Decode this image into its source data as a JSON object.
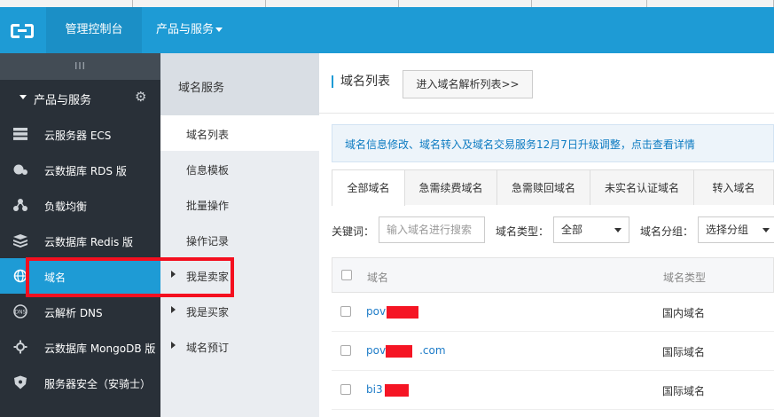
{
  "header": {
    "console_label": "管理控制台",
    "products_label": "产品与服务"
  },
  "sidebar": {
    "toggle_label": "III",
    "section_label": "产品与服务",
    "items": [
      {
        "label": "云服务器 ECS",
        "icon": "server-icon"
      },
      {
        "label": "云数据库 RDS 版",
        "icon": "database-icon"
      },
      {
        "label": "负载均衡",
        "icon": "load-balancer-icon"
      },
      {
        "label": "云数据库 Redis 版",
        "icon": "redis-icon"
      },
      {
        "label": "域名",
        "icon": "globe-icon",
        "active": true
      },
      {
        "label": "云解析 DNS",
        "icon": "dns-icon"
      },
      {
        "label": "云数据库 MongoDB 版",
        "icon": "mongodb-icon"
      },
      {
        "label": "服务器安全（安骑士）",
        "icon": "shield-icon"
      }
    ]
  },
  "subnav": {
    "title": "域名服务",
    "items": [
      {
        "label": "域名列表",
        "expandable": false,
        "active": true
      },
      {
        "label": "信息模板",
        "expandable": false
      },
      {
        "label": "批量操作",
        "expandable": false
      },
      {
        "label": "操作记录",
        "expandable": false
      },
      {
        "label": "我是卖家",
        "expandable": true
      },
      {
        "label": "我是买家",
        "expandable": true
      },
      {
        "label": "域名预订",
        "expandable": true
      }
    ]
  },
  "main": {
    "title": "域名列表",
    "dns_button": "进入域名解析列表>>",
    "notice": "域名信息修改、域名转入及域名交易服务12月7日升级调整，点击查看详情",
    "tabs": [
      "全部域名",
      "急需续费域名",
      "急需赎回域名",
      "未实名认证域名",
      "转入域名"
    ],
    "filters": {
      "keyword_label": "关键词：",
      "keyword_placeholder": "输入域名进行搜索",
      "type_label": "域名类型：",
      "type_value": "全部",
      "group_label": "域名分组：",
      "group_value": "选择分组"
    },
    "table": {
      "headers": [
        "域名",
        "域名类型"
      ],
      "rows": [
        {
          "domain_prefix": "pov",
          "domain_suffix": "",
          "type": "国内域名"
        },
        {
          "domain_prefix": "pov",
          "domain_suffix": ".com",
          "type": "国际域名"
        },
        {
          "domain_prefix": "bi3",
          "domain_suffix": "",
          "type": "国际域名"
        }
      ]
    }
  },
  "colors": {
    "brand": "#1e9bd5",
    "sidebar_bg": "#293038",
    "highlight_box": "#f40f1f",
    "link": "#1e7cc8"
  }
}
